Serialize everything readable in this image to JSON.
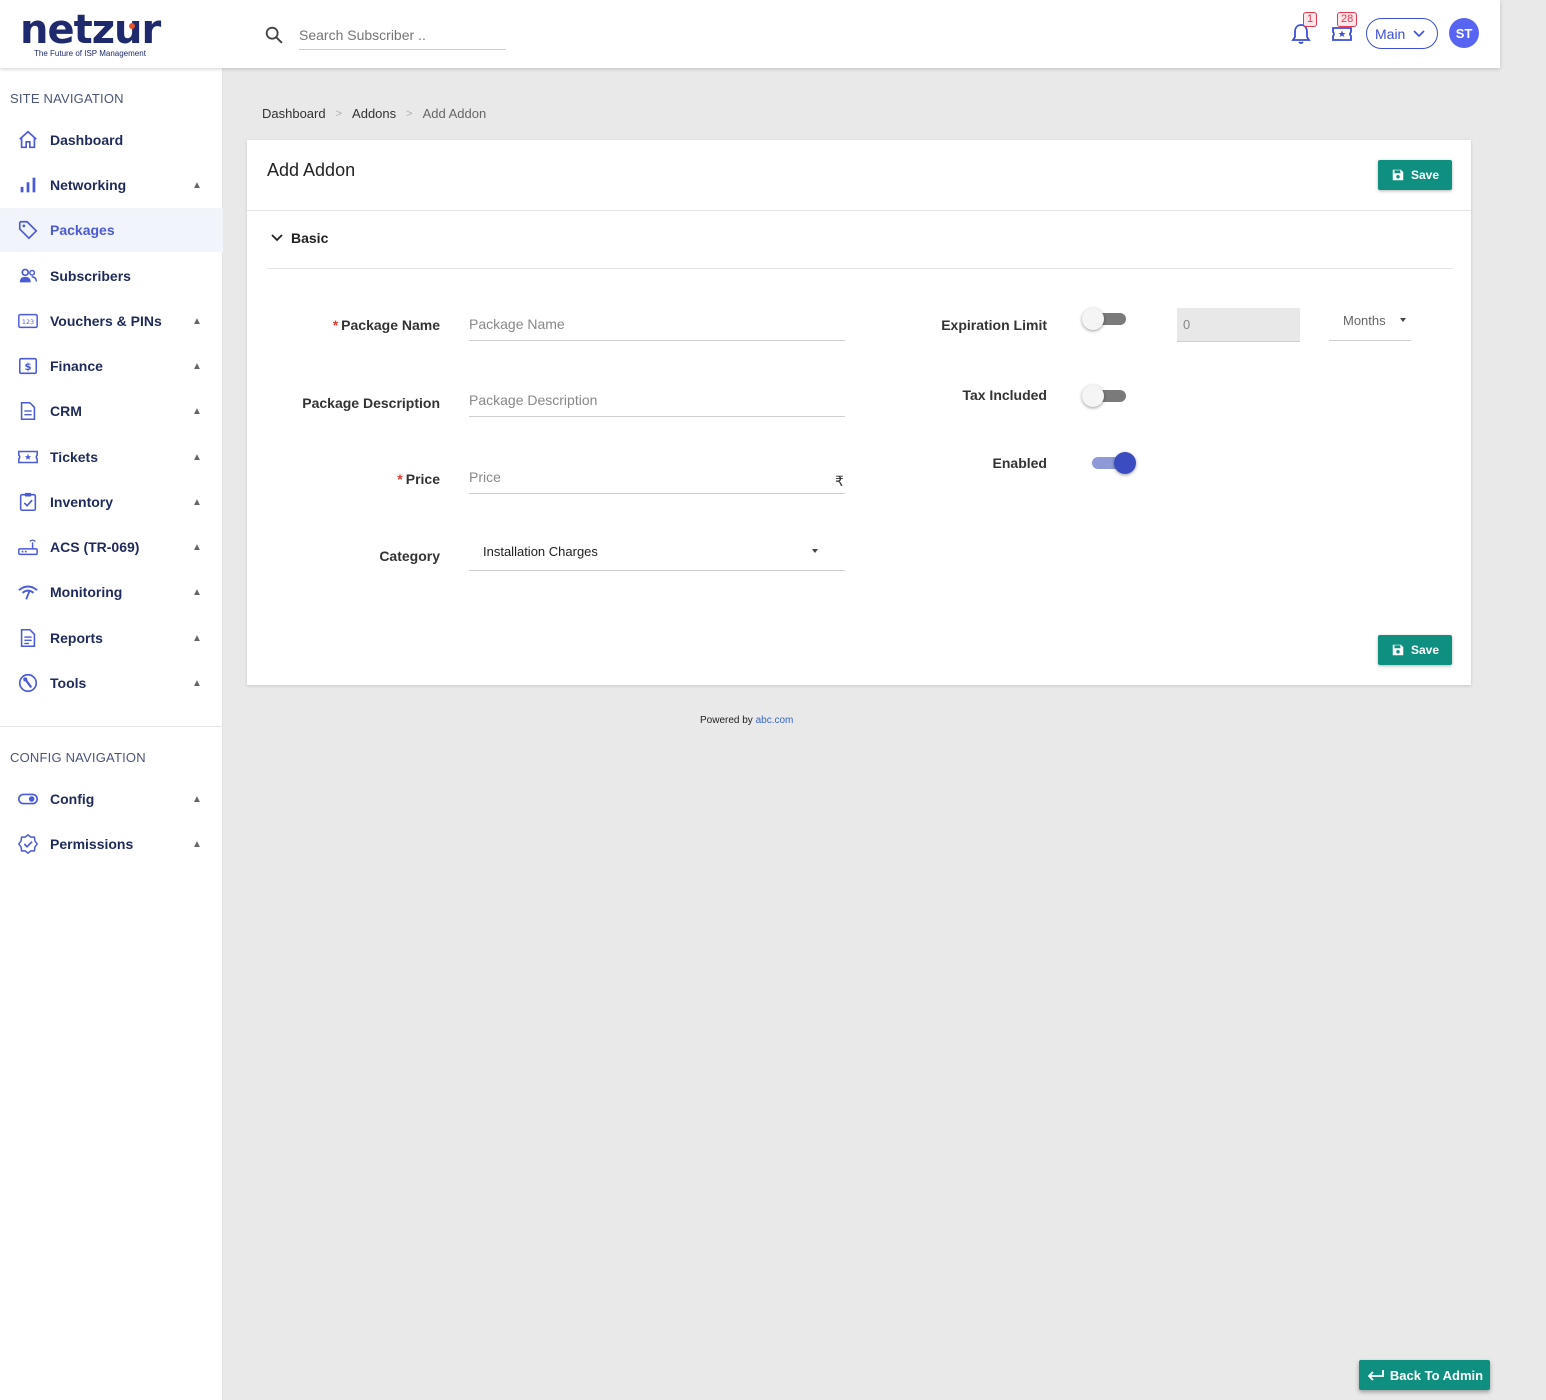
{
  "brand": {
    "name": "netzur",
    "tagline": "The Future of ISP Management",
    "accent": "#3c4fd6",
    "save_color": "#0e8f7f"
  },
  "header": {
    "search_placeholder": "Search Subscriber ..",
    "notifications_count": "1",
    "tickets_count": "28",
    "branch_select": "Main",
    "avatar_initials": "ST"
  },
  "sidebar": {
    "site_nav_title": "SITE NAVIGATION",
    "config_nav_title": "CONFIG NAVIGATION",
    "site_items": [
      {
        "label": "Dashboard",
        "icon": "home-icon",
        "expandable": false,
        "active": false
      },
      {
        "label": "Networking",
        "icon": "bar-chart-icon",
        "expandable": true,
        "active": false
      },
      {
        "label": "Packages",
        "icon": "tag-icon",
        "expandable": false,
        "active": true
      },
      {
        "label": "Subscribers",
        "icon": "people-icon",
        "expandable": false,
        "active": false
      },
      {
        "label": "Vouchers & PINs",
        "icon": "pin-123-icon",
        "expandable": true,
        "active": false
      },
      {
        "label": "Finance",
        "icon": "dollar-icon",
        "expandable": true,
        "active": false
      },
      {
        "label": "CRM",
        "icon": "document-icon",
        "expandable": true,
        "active": false
      },
      {
        "label": "Tickets",
        "icon": "ticket-icon",
        "expandable": true,
        "active": false
      },
      {
        "label": "Inventory",
        "icon": "clipboard-check-icon",
        "expandable": true,
        "active": false
      },
      {
        "label": "ACS (TR-069)",
        "icon": "router-icon",
        "expandable": true,
        "active": false
      },
      {
        "label": "Monitoring",
        "icon": "signal-icon",
        "expandable": true,
        "active": false
      },
      {
        "label": "Reports",
        "icon": "report-icon",
        "expandable": true,
        "active": false
      },
      {
        "label": "Tools",
        "icon": "wrench-icon",
        "expandable": true,
        "active": false
      }
    ],
    "config_items": [
      {
        "label": "Config",
        "icon": "toggle-icon",
        "expandable": true
      },
      {
        "label": "Permissions",
        "icon": "verified-icon",
        "expandable": true
      }
    ]
  },
  "breadcrumb": {
    "items": [
      "Dashboard",
      "Addons"
    ],
    "current": "Add Addon",
    "separator": ">"
  },
  "form": {
    "title": "Add Addon",
    "save_label": "Save",
    "section_label": "Basic",
    "package_name": {
      "label": "Package Name",
      "placeholder": "Package Name",
      "value": ""
    },
    "package_description": {
      "label": "Package Description",
      "placeholder": "Package Description",
      "value": ""
    },
    "price": {
      "label": "Price",
      "placeholder": "Price",
      "currency": "₹"
    },
    "category": {
      "label": "Category",
      "value": "Installation Charges"
    },
    "expiration_limit": {
      "label": "Expiration Limit",
      "enabled": false,
      "value": "0",
      "unit": "Months"
    },
    "tax_included": {
      "label": "Tax Included",
      "enabled": false
    },
    "enabled": {
      "label": "Enabled",
      "enabled": true
    }
  },
  "footer": {
    "powered_by": "Powered by",
    "link": "abc.com"
  },
  "back_button": "Back To Admin"
}
